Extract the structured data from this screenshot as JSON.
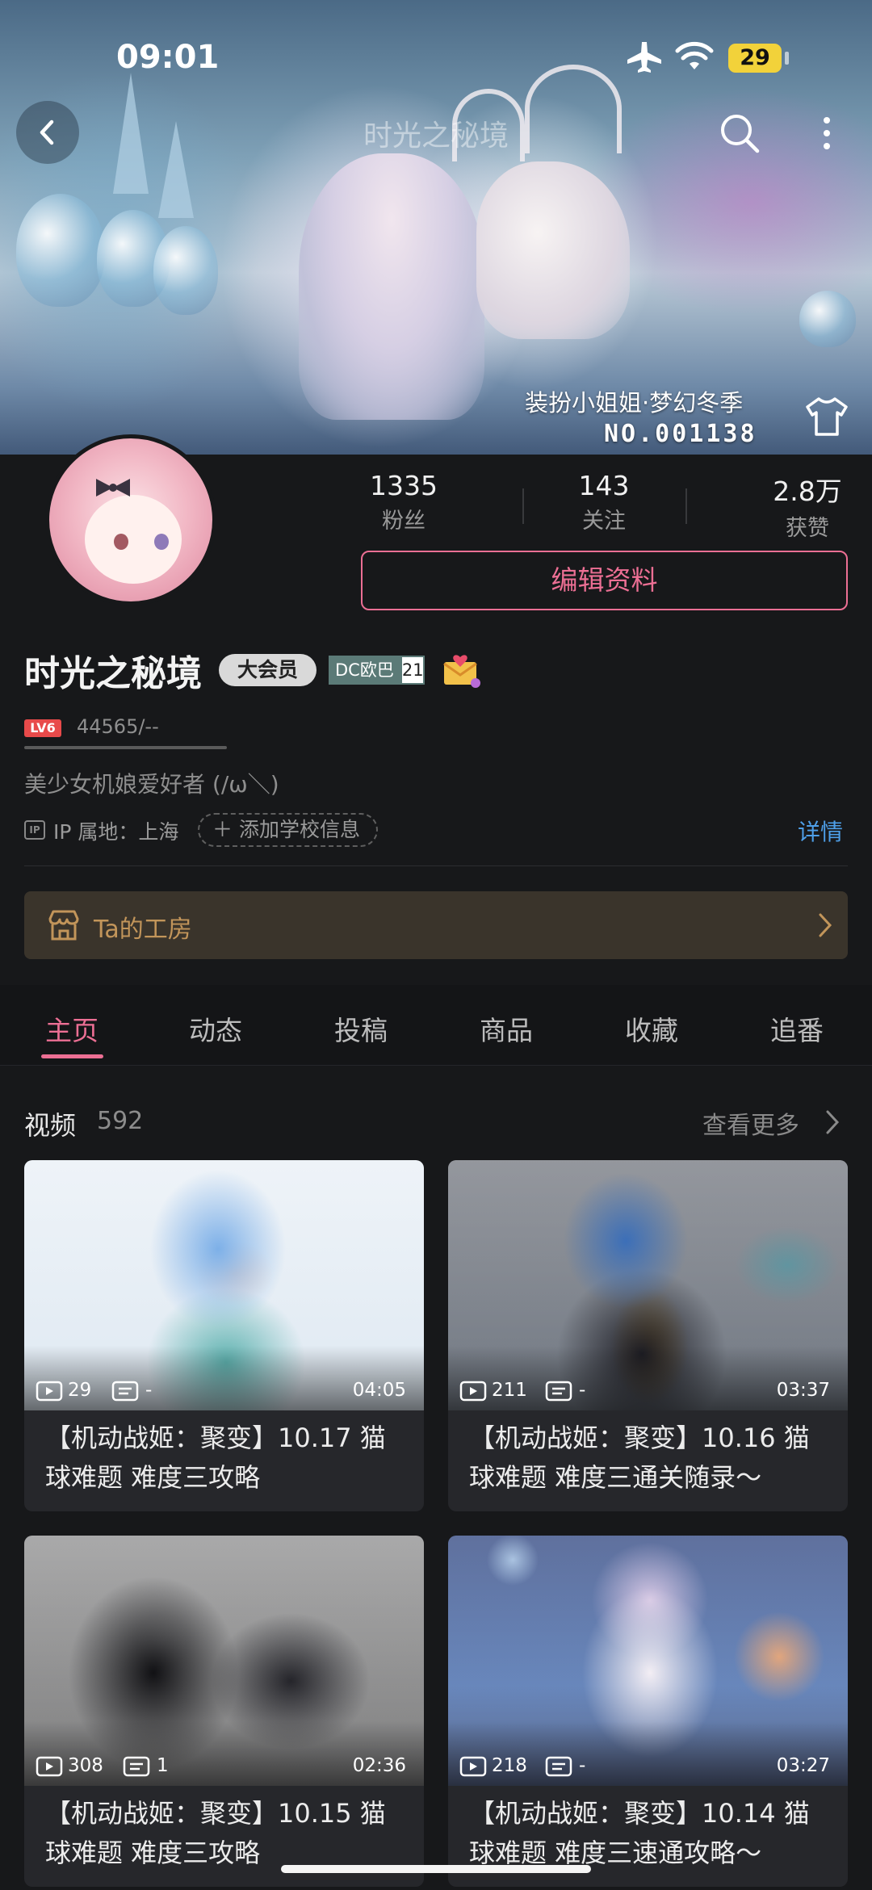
{
  "status_bar": {
    "time": "09:01",
    "battery": "29"
  },
  "nav": {
    "title": "时光之秘境"
  },
  "banner": {
    "skin_name": "装扮小姐姐·梦幻冬季",
    "skin_number": "NO.001138"
  },
  "profile": {
    "stats": [
      {
        "value": "1335",
        "label": "粉丝"
      },
      {
        "value": "143",
        "label": "关注"
      },
      {
        "value": "2.8万",
        "label": "获赞"
      }
    ],
    "edit_button": "编辑资料",
    "name": "时光之秘境",
    "vip_badge": "大会员",
    "medal": {
      "name": "DC欧巴",
      "level": "21"
    },
    "level": "LV6",
    "exp": "44565/--",
    "signature": "美少女机娘爱好者 (/ω＼)",
    "ip_badge": "IP",
    "ip_location": "IP 属地：上海",
    "add_school": "添加学校信息",
    "detail_link": "详情"
  },
  "workshop": {
    "label": "Ta的工房"
  },
  "tabs": [
    "主页",
    "动态",
    "投稿",
    "商品",
    "收藏",
    "追番"
  ],
  "videos_section": {
    "title": "视频",
    "count": "592",
    "more": "查看更多"
  },
  "videos": [
    {
      "plays": "29",
      "danmaku": "-",
      "duration": "04:05",
      "title": "【机动战姬：聚变】10.17 猫球难题 难度三攻略"
    },
    {
      "plays": "211",
      "danmaku": "-",
      "duration": "03:37",
      "title": "【机动战姬：聚变】10.16 猫球难题 难度三通关随录～"
    },
    {
      "plays": "308",
      "danmaku": "1",
      "duration": "02:36",
      "title": "【机动战姬：聚变】10.15 猫球难题 难度三攻略"
    },
    {
      "plays": "218",
      "danmaku": "-",
      "duration": "03:27",
      "title": "【机动战姬：聚变】10.14 猫球难题 难度三速通攻略～"
    }
  ],
  "colors": {
    "accent": "#ec6f94",
    "link": "#4e9fe8",
    "workshop": "#c2955a",
    "background": "#17181a"
  }
}
